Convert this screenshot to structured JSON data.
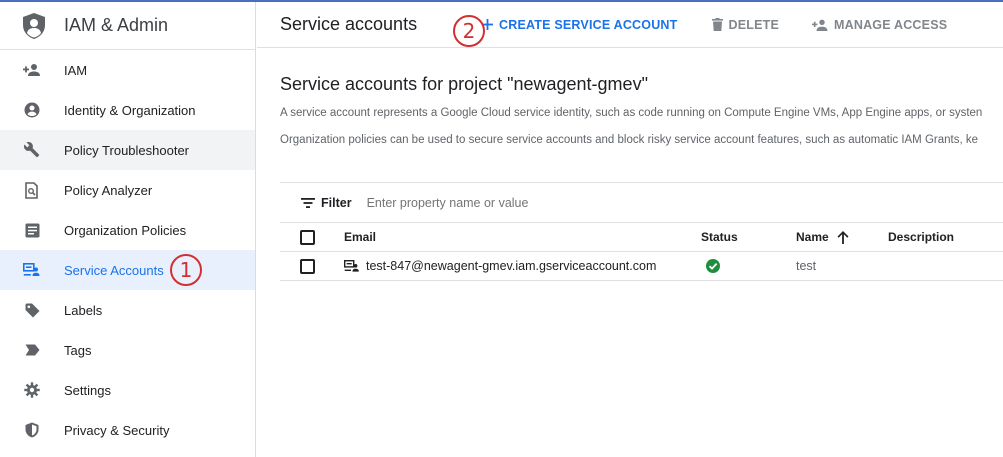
{
  "sidebar": {
    "app_title": "IAM & Admin",
    "items": [
      {
        "label": "IAM",
        "icon": "person-add-icon"
      },
      {
        "label": "Identity & Organization",
        "icon": "account-circle-icon"
      },
      {
        "label": "Policy Troubleshooter",
        "icon": "wrench-icon"
      },
      {
        "label": "Policy Analyzer",
        "icon": "document-search-icon"
      },
      {
        "label": "Organization Policies",
        "icon": "article-icon"
      },
      {
        "label": "Service Accounts",
        "icon": "service-account-icon"
      },
      {
        "label": "Labels",
        "icon": "tag-icon"
      },
      {
        "label": "Tags",
        "icon": "label-arrow-icon"
      },
      {
        "label": "Settings",
        "icon": "gear-icon"
      },
      {
        "label": "Privacy & Security",
        "icon": "shield-icon"
      }
    ],
    "annotation": "1"
  },
  "toolbar": {
    "title": "Service accounts",
    "create_label": "CREATE SERVICE ACCOUNT",
    "delete_label": "DELETE",
    "manage_label": "MANAGE ACCESS",
    "annotation": "2"
  },
  "main": {
    "section_title": "Service accounts for project \"newagent-gmev\"",
    "description": "A service account represents a Google Cloud service identity, such as code running on Compute Engine VMs, App Engine apps, or systen",
    "policy_note": "Organization policies can be used to secure service accounts and block risky service account features, such as automatic IAM Grants, ke"
  },
  "table": {
    "filter_label": "Filter",
    "filter_placeholder": "Enter property name or value",
    "headers": {
      "email": "Email",
      "status": "Status",
      "name": "Name",
      "description": "Description"
    },
    "rows": [
      {
        "email": "test-847@newagent-gmev.iam.gserviceaccount.com",
        "status": "enabled",
        "name": "test",
        "description": ""
      }
    ]
  },
  "colors": {
    "accent": "#1a73e8",
    "active_bg": "#e8f0fe",
    "annotation": "#d32f2f",
    "status_ok": "#1e8e3e"
  }
}
